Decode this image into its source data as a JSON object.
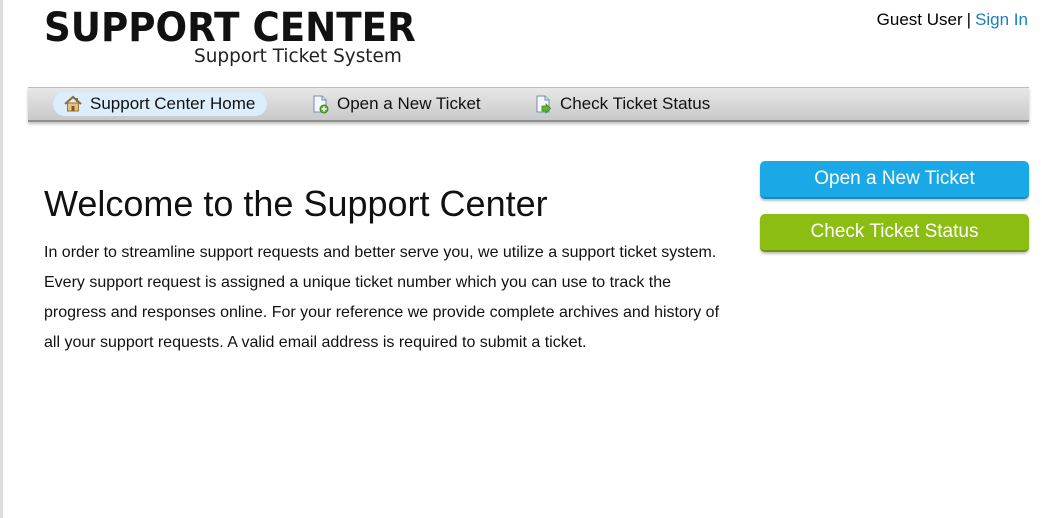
{
  "header": {
    "logo_title": "SUPPORT CENTER",
    "logo_subtitle": "Support Ticket System",
    "user_label": "Guest User",
    "separator": "|",
    "sign_in_label": "Sign In"
  },
  "nav": {
    "items": [
      {
        "label": "Support Center Home",
        "icon": "home-icon",
        "active": true
      },
      {
        "label": "Open a New Ticket",
        "icon": "new-ticket-icon",
        "active": false
      },
      {
        "label": "Check Ticket Status",
        "icon": "ticket-status-icon",
        "active": false
      }
    ]
  },
  "main": {
    "title": "Welcome to the Support Center",
    "intro": "In order to streamline support requests and better serve you, we utilize a support ticket system. Every support request is assigned a unique ticket number which you can use to track the progress and responses online. For your reference we provide complete archives and history of all your support requests. A valid email address is required to submit a ticket."
  },
  "sidebar": {
    "open_ticket_label": "Open a New Ticket",
    "check_status_label": "Check Ticket Status"
  },
  "colors": {
    "link": "#1a7fc1",
    "open_button": "#1aa9e6",
    "status_button": "#8cbd12",
    "active_nav": "#dceefb"
  }
}
